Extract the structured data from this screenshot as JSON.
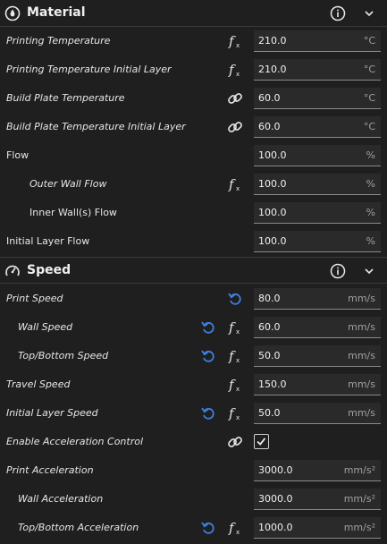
{
  "material": {
    "title": "Material",
    "rows": [
      {
        "label": "Printing Temperature",
        "value": "210.0",
        "unit": "°C"
      },
      {
        "label": "Printing Temperature Initial Layer",
        "value": "210.0",
        "unit": "°C"
      },
      {
        "label": "Build Plate Temperature",
        "value": "60.0",
        "unit": "°C"
      },
      {
        "label": "Build Plate Temperature Initial Layer",
        "value": "60.0",
        "unit": "°C"
      },
      {
        "label": "Flow",
        "value": "100.0",
        "unit": "%"
      },
      {
        "label": "Outer Wall Flow",
        "value": "100.0",
        "unit": "%"
      },
      {
        "label": "Inner Wall(s) Flow",
        "value": "100.0",
        "unit": "%"
      },
      {
        "label": "Initial Layer Flow",
        "value": "100.0",
        "unit": "%"
      }
    ]
  },
  "speed": {
    "title": "Speed",
    "rows": [
      {
        "label": "Print Speed",
        "value": "80.0",
        "unit": "mm/s"
      },
      {
        "label": "Wall Speed",
        "value": "60.0",
        "unit": "mm/s"
      },
      {
        "label": "Top/Bottom Speed",
        "value": "50.0",
        "unit": "mm/s"
      },
      {
        "label": "Travel Speed",
        "value": "150.0",
        "unit": "mm/s"
      },
      {
        "label": "Initial Layer Speed",
        "value": "50.0",
        "unit": "mm/s"
      },
      {
        "label": "Enable Acceleration Control",
        "checked": true
      },
      {
        "label": "Print Acceleration",
        "value": "3000.0",
        "unit": "mm/s²"
      },
      {
        "label": "Wall Acceleration",
        "value": "3000.0",
        "unit": "mm/s²"
      },
      {
        "label": "Top/Bottom Acceleration",
        "value": "1000.0",
        "unit": "mm/s²"
      }
    ]
  },
  "icons": {
    "function": "function-icon",
    "link": "link-icon",
    "reset": "reset-icon",
    "info": "info-icon",
    "collapse": "chevron-down-icon",
    "material": "material-icon",
    "speed": "speedometer-icon"
  },
  "colors": {
    "background": "#1f1f1f",
    "field": "#2a2a2a",
    "reset_blue": "#3d7fe0"
  }
}
